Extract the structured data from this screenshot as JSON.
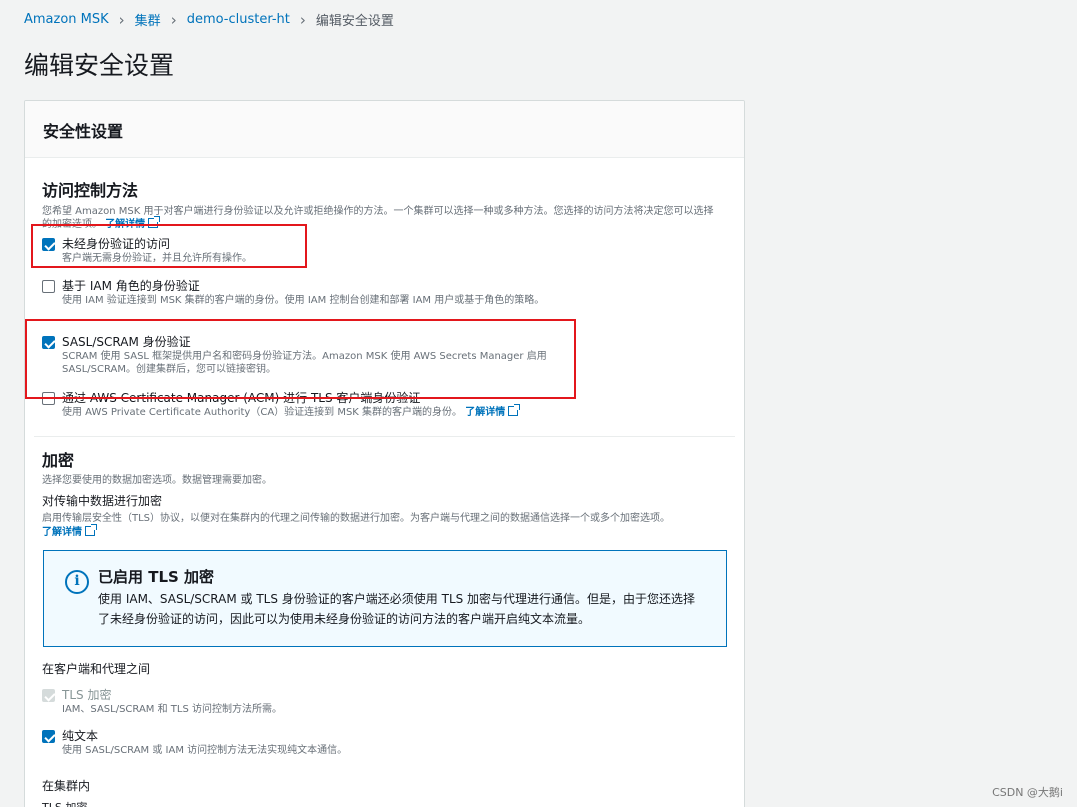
{
  "breadcrumb": {
    "items": [
      "Amazon MSK",
      "集群",
      "demo-cluster-ht"
    ],
    "current": "编辑安全设置"
  },
  "page_title": "编辑安全设置",
  "panel": {
    "header": "安全性设置",
    "access_control": {
      "heading": "访问控制方法",
      "description": "您希望 Amazon MSK 用于对客户端进行身份验证以及允许或拒绝操作的方法。一个集群可以选择一种或多种方法。您选择的访问方法将决定您可以选择的加密选项。",
      "learn_more": "了解详情",
      "options": [
        {
          "label": "未经身份验证的访问",
          "desc": "客户端无需身份验证，并且允许所有操作。",
          "checked": true
        },
        {
          "label": "基于 IAM 角色的身份验证",
          "desc": "使用 IAM 验证连接到 MSK 集群的客户端的身份。使用 IAM 控制台创建和部署 IAM 用户或基于角色的策略。",
          "checked": false
        },
        {
          "label": "SASL/SCRAM 身份验证",
          "desc": "SCRAM 使用 SASL 框架提供用户名和密码身份验证方法。Amazon MSK 使用 AWS Secrets Manager 启用 SASL/SCRAM。创建集群后，您可以链接密钥。",
          "checked": true
        },
        {
          "label": "通过 AWS Certificate Manager (ACM) 进行 TLS 客户端身份验证",
          "desc": "使用 AWS Private Certificate Authority（CA）验证连接到 MSK 集群的客户端的身份。",
          "learn_more": "了解详情",
          "checked": false
        }
      ]
    },
    "encryption": {
      "heading": "加密",
      "description": "选择您要使用的数据加密选项。数据管理需要加密。",
      "in_transit_label": "对传输中数据进行加密",
      "in_transit_desc": "启用传输层安全性（TLS）协议，以便对在集群内的代理之间传输的数据进行加密。为客户端与代理之间的数据通信选择一个或多个加密选项。",
      "learn_more": "了解详情",
      "alert": {
        "title": "已启用 TLS 加密",
        "body": "使用 IAM、SASL/SCRAM 或 TLS 身份验证的客户端还必须使用 TLS 加密与代理进行通信。但是，由于您还选择了未经身份验证的访问，因此可以为使用未经身份验证的访问方法的客户端开启纯文本流量。"
      },
      "between_clients_label": "在客户端和代理之间",
      "tls_option": {
        "label": "TLS 加密",
        "desc": "IAM、SASL/SCRAM 和 TLS 访问控制方法所需。"
      },
      "plaintext_option": {
        "label": "纯文本",
        "desc": "使用 SASL/SCRAM 或 IAM 访问控制方法无法实现纯文本通信。"
      },
      "within_cluster_label": "在集群内",
      "within_tls_label": "TLS 加密"
    }
  },
  "watermark": "CSDN @大鹅i",
  "colors": {
    "link": "#0073bb",
    "highlight": "#e3171c",
    "alert_bg": "#f1faff"
  }
}
